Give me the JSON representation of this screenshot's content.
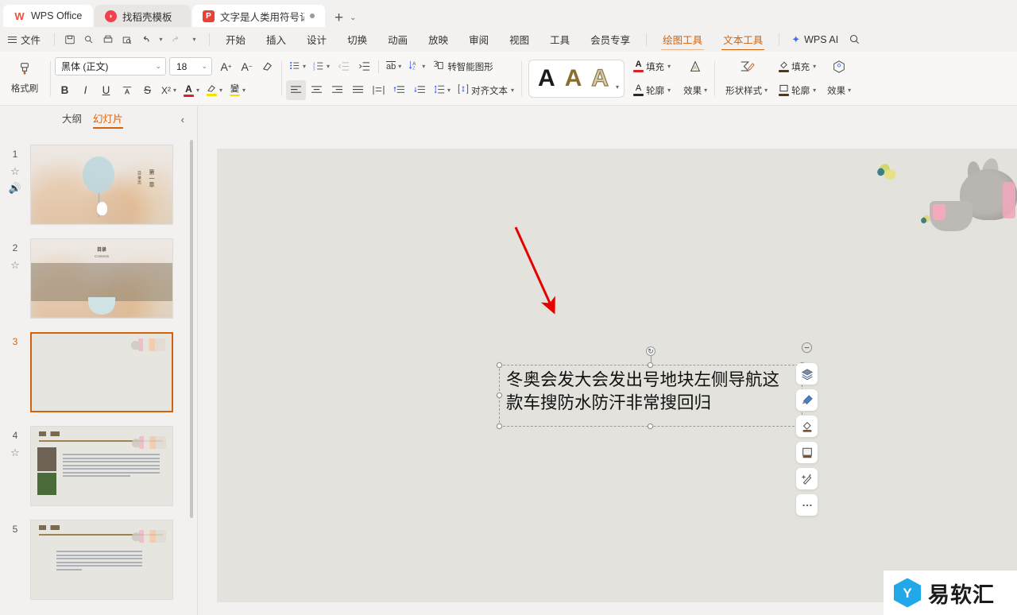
{
  "window": {
    "tabs": [
      {
        "label": "WPS Office",
        "icon": "wps-logo-icon",
        "state": "inactive"
      },
      {
        "label": "找稻壳模板",
        "icon": "docer-icon",
        "state": "inactive"
      },
      {
        "label": "文字是人类用符号记录表达信息以",
        "icon": "presentation-icon",
        "state": "active"
      }
    ],
    "new_tab_label": "+",
    "tab_list_caret": "⌄"
  },
  "menubar": {
    "file_label": "文件",
    "quick_access": [
      "save-icon",
      "search-doc-icon",
      "print-icon",
      "print-preview-icon",
      "undo-icon",
      "redo-icon",
      "customize-caret-icon"
    ],
    "items": [
      "开始",
      "插入",
      "设计",
      "切换",
      "动画",
      "放映",
      "审阅",
      "视图",
      "工具",
      "会员专享"
    ],
    "context_tabs": [
      {
        "label": "绘图工具",
        "active": false
      },
      {
        "label": "文本工具",
        "active": true
      }
    ],
    "ai_label": "WPS AI",
    "search_icon": "search-icon"
  },
  "ribbon": {
    "format_painter": "格式刷",
    "font_name": "黑体 (正文)",
    "font_size": "18",
    "grow_font": "A",
    "shrink_font": "A",
    "clear_format_icon": "clear-format-icon",
    "bold": "B",
    "italic": "I",
    "underline": "U",
    "pinyin": "A",
    "strikethrough": "S",
    "superscript": "X²",
    "font_color_icon": "A",
    "highlight_icon": "highlight-icon",
    "char_shading_icon": "text-effect-icon",
    "bullets_icon": "bullet-list-icon",
    "numbering_icon": "numbered-list-icon",
    "decrease_indent_icon": "decrease-indent-icon",
    "increase_indent_icon": "increase-indent-icon",
    "text_direction_icon": "ab",
    "paragraph_sort_icon": "sort-icon",
    "smartart_label": "转智能图形",
    "align_left_icon": "align-left-icon",
    "align_center_icon": "align-center-icon",
    "align_right_icon": "align-right-icon",
    "justify_icon": "justify-icon",
    "distribute_icon": "distribute-icon",
    "line_space_before_icon": "space-before-icon",
    "line_space_after_icon": "space-after-icon",
    "line_spacing_icon": "line-spacing-icon",
    "align_text_label": "对齐文本",
    "wordart_samples": [
      "A",
      "A",
      "A"
    ],
    "text_fill_label": "填充",
    "text_outline_label": "轮廓",
    "text_effect_label": "效果",
    "shape_style_label": "形状样式",
    "shape_fill_label": "填充",
    "shape_outline_label": "轮廓",
    "shape_effect_label": "效果"
  },
  "slide_panel": {
    "tabs": [
      {
        "label": "大纲",
        "active": false
      },
      {
        "label": "幻灯片",
        "active": true
      }
    ],
    "collapse_icon": "chevron-left-icon",
    "slides": [
      {
        "number": "1",
        "icons": [
          "animation-star-icon",
          "audio-icon"
        ],
        "kind": "title",
        "title": "第一章",
        "subtitle": "目录页"
      },
      {
        "number": "2",
        "icons": [
          "animation-star-icon"
        ],
        "kind": "contents",
        "title": "目录",
        "subtitle": "Contents"
      },
      {
        "number": "3",
        "icons": [],
        "kind": "blank",
        "selected": true
      },
      {
        "number": "4",
        "icons": [
          "animation-star-icon"
        ],
        "kind": "photo-text",
        "title": "第一章"
      },
      {
        "number": "5",
        "icons": [],
        "kind": "text",
        "title": "第一章"
      }
    ]
  },
  "canvas": {
    "selected_textbox": {
      "text": "冬奥会发大会发出号地块左侧导航这款车搜防水防汗非常搜回归",
      "rotate_handle": "rotate-icon",
      "handles": 8
    },
    "annotation": {
      "type": "red-arrow",
      "color": "#e60000"
    },
    "decorations": [
      "butterfly",
      "butterfly",
      "rabbit-illustration"
    ]
  },
  "float_toolbar": {
    "buttons": [
      {
        "name": "collapse-toolbar-button",
        "icon": "minus-circle-icon"
      },
      {
        "name": "layers-button",
        "icon": "layers-icon"
      },
      {
        "name": "format-painter-button",
        "icon": "brush-icon"
      },
      {
        "name": "fill-button",
        "icon": "paint-bucket-icon"
      },
      {
        "name": "frame-button",
        "icon": "frame-icon"
      },
      {
        "name": "effects-button",
        "icon": "magic-wand-icon"
      },
      {
        "name": "more-button",
        "icon": "more-dots-icon"
      }
    ]
  },
  "watermark": {
    "text": "易软汇",
    "logo_icon": "yiruanhui-logo-icon"
  }
}
